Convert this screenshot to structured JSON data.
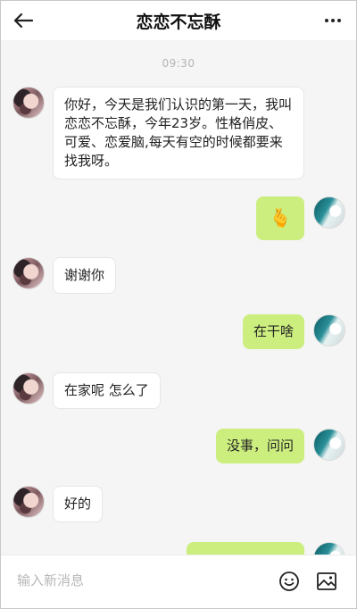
{
  "header": {
    "title": "恋恋不忘酥"
  },
  "timestamp": "09:30",
  "messages": [
    {
      "from": "her",
      "text": "你好，今天是我们认识的第一天，我叫恋恋不忘酥，今年23岁。性格俏皮、可爱、恋爱脑,每天有空的时候都要来找我呀。"
    },
    {
      "from": "me",
      "text": "🫰"
    },
    {
      "from": "her",
      "text": "谢谢你"
    },
    {
      "from": "me",
      "text": "在干啥"
    },
    {
      "from": "her",
      "text": "在家呢 怎么了"
    },
    {
      "from": "me",
      "text": "没事，问问"
    },
    {
      "from": "her",
      "text": "好的"
    },
    {
      "from": "me",
      "text": ""
    }
  ],
  "composer": {
    "placeholder": "输入新消息"
  },
  "icons": {
    "back": "back-arrow-icon",
    "more": "more-icon",
    "emoji": "emoji-icon",
    "image": "image-icon"
  },
  "colors": {
    "outgoing_bubble": "#ccee7f",
    "incoming_bubble": "#ffffff",
    "background": "#f5f5f5"
  }
}
